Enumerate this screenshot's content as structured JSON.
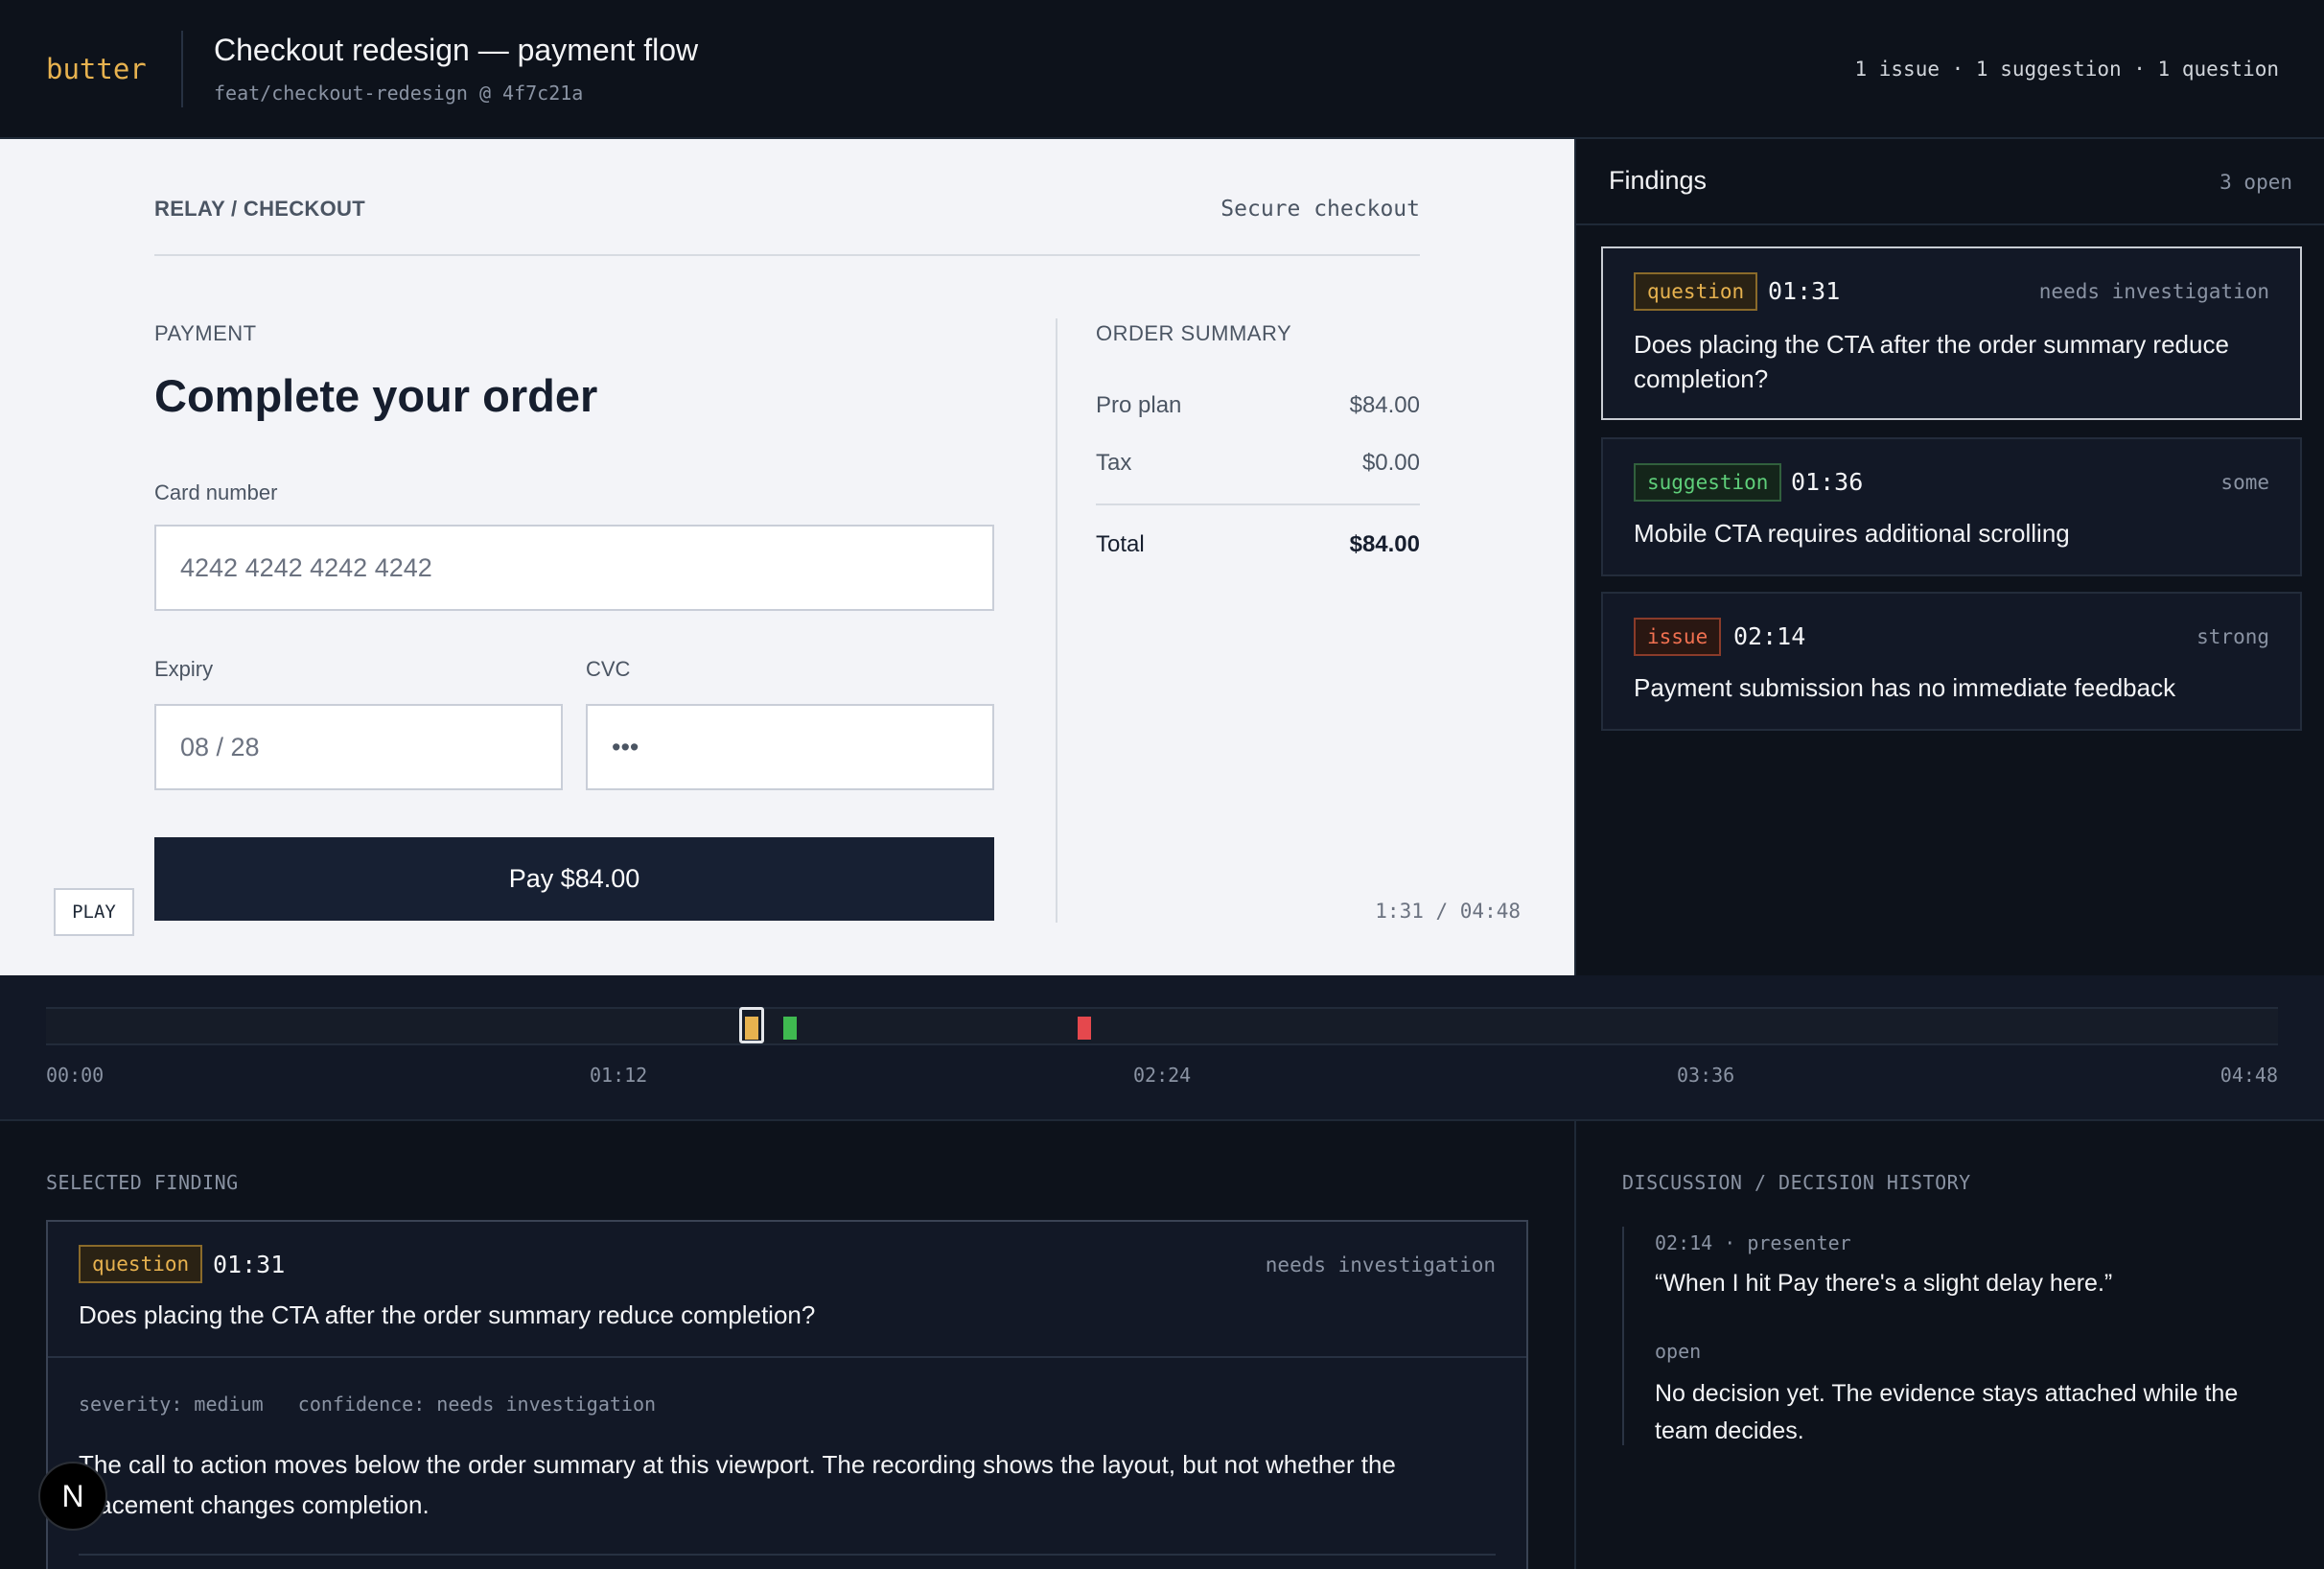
{
  "header": {
    "logo": "butter",
    "title": "Checkout redesign — payment flow",
    "branch": "feat/checkout-redesign @ 4f7c21a",
    "counts": "1 issue · 1 suggestion · 1 question"
  },
  "preview": {
    "breadcrumb": "RELAY / CHECKOUT",
    "secure": "Secure checkout",
    "payment_label": "PAYMENT",
    "heading": "Complete your order",
    "card_label": "Card number",
    "card_placeholder": "4242 4242 4242 4242",
    "expiry_label": "Expiry",
    "expiry_placeholder": "08 / 28",
    "cvc_label": "CVC",
    "cvc_value": "•••",
    "pay_button": "Pay $84.00",
    "summary_label": "ORDER SUMMARY",
    "summary_rows": [
      {
        "label": "Pro plan",
        "amount": "$84.00"
      },
      {
        "label": "Tax",
        "amount": "$0.00"
      }
    ],
    "total": {
      "label": "Total",
      "amount": "$84.00"
    },
    "play_button": "PLAY",
    "time": "1:31 / 04:48"
  },
  "findings": {
    "title": "Findings",
    "open_count": "3 open",
    "items": [
      {
        "type": "question",
        "time": "01:31",
        "confidence": "needs investigation",
        "text": "Does placing the CTA after the order summary reduce completion?"
      },
      {
        "type": "suggestion",
        "time": "01:36",
        "confidence": "some",
        "text": "Mobile CTA requires additional scrolling"
      },
      {
        "type": "issue",
        "time": "02:14",
        "confidence": "strong",
        "text": "Payment submission has no immediate feedback"
      }
    ]
  },
  "timeline": {
    "duration_seconds": 288,
    "markers": [
      {
        "type": "question",
        "seconds": 91,
        "color": "#e7b24f",
        "selected": true
      },
      {
        "type": "suggestion",
        "seconds": 96,
        "color": "#3fb950"
      },
      {
        "type": "issue",
        "seconds": 134,
        "color": "#e5484d"
      }
    ],
    "ticks": [
      "00:00",
      "01:12",
      "02:24",
      "03:36",
      "04:48"
    ]
  },
  "selected_finding": {
    "section_label": "SELECTED FINDING",
    "type": "question",
    "time": "01:31",
    "confidence": "needs investigation",
    "title": "Does placing the CTA after the order summary reduce completion?",
    "meta": "severity: medium   confidence: needs investigation",
    "body": "The call to action moves below the order summary at this viewport. The recording shows the layout, but not whether the placement changes completion."
  },
  "discussion": {
    "section_label": "DISCUSSION / DECISION HISTORY",
    "entries": [
      {
        "meta": "02:14 · presenter",
        "text": "“When I hit Pay there's a slight delay here.”"
      },
      {
        "meta": "open",
        "text": "No decision yet. The evidence stays attached while the team decides."
      }
    ]
  },
  "badge": "N"
}
